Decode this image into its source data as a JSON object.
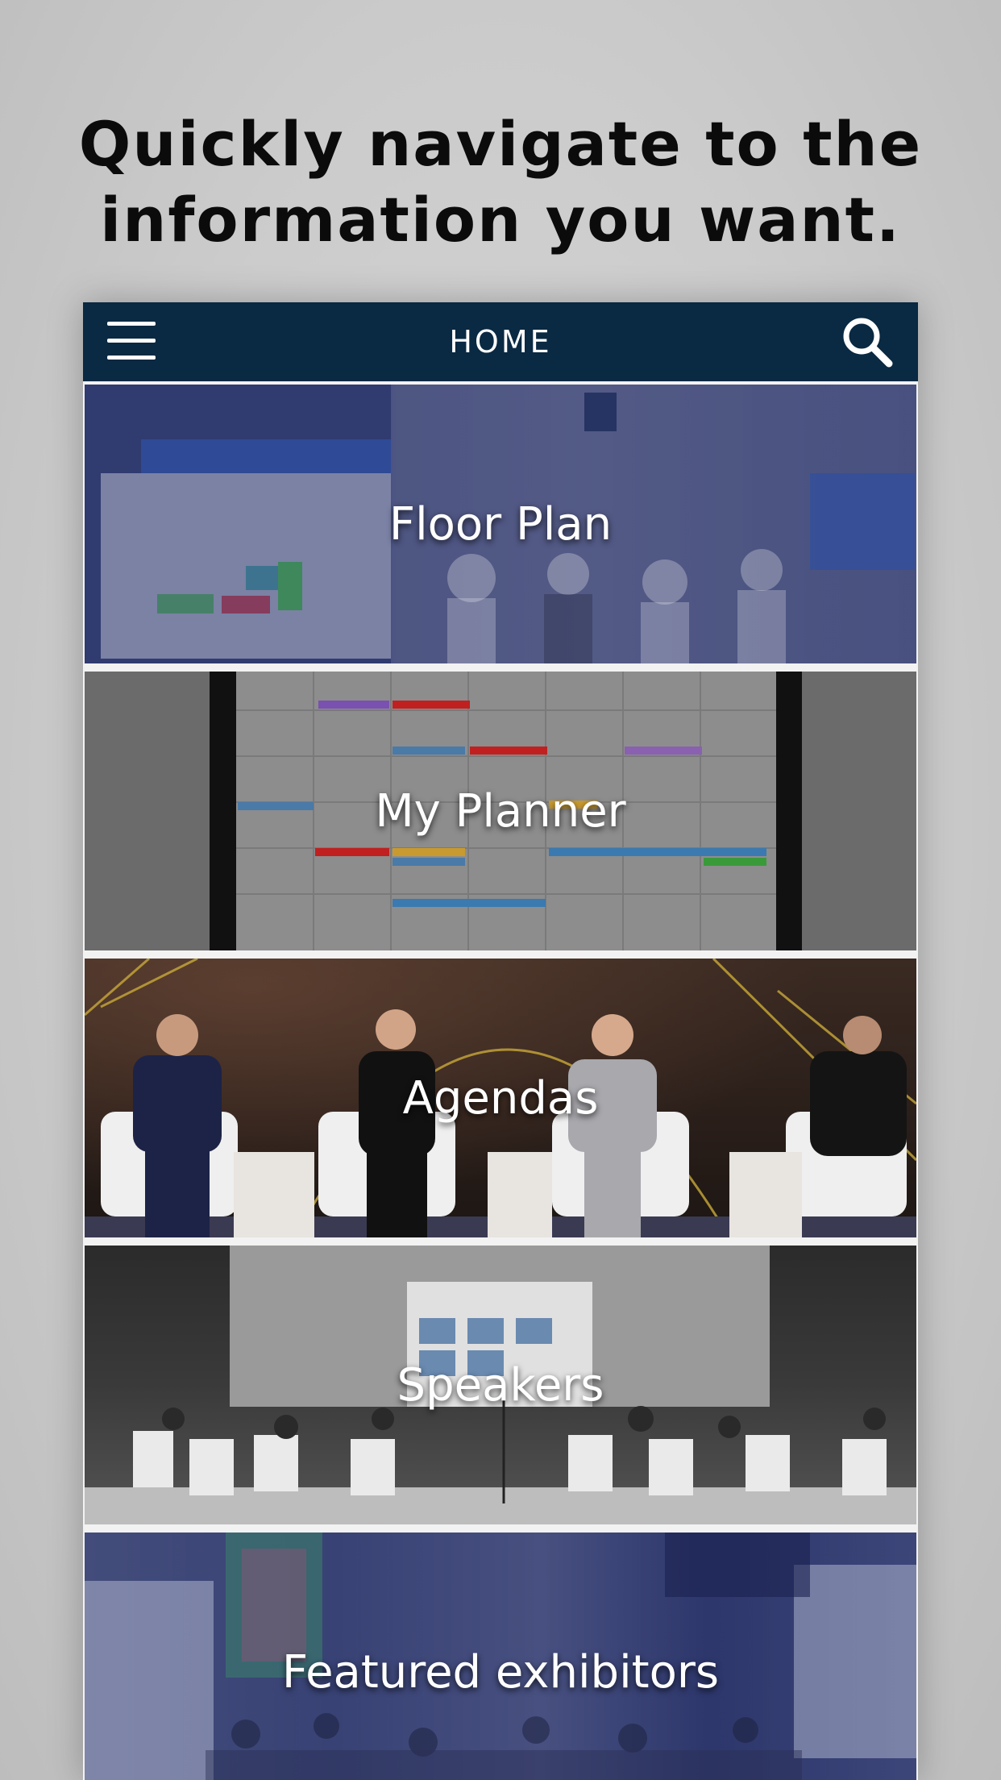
{
  "headline": {
    "line1": "Quickly navigate to the",
    "line2": "information you want."
  },
  "navbar": {
    "title": "HOME",
    "menu_icon": "hamburger-menu-icon",
    "search_icon": "search-icon",
    "background_color": "#0a2942"
  },
  "tiles": [
    {
      "label": "Floor Plan"
    },
    {
      "label": "My Planner"
    },
    {
      "label": "Agendas"
    },
    {
      "label": "Speakers"
    },
    {
      "label": "Featured exhibitors"
    }
  ]
}
